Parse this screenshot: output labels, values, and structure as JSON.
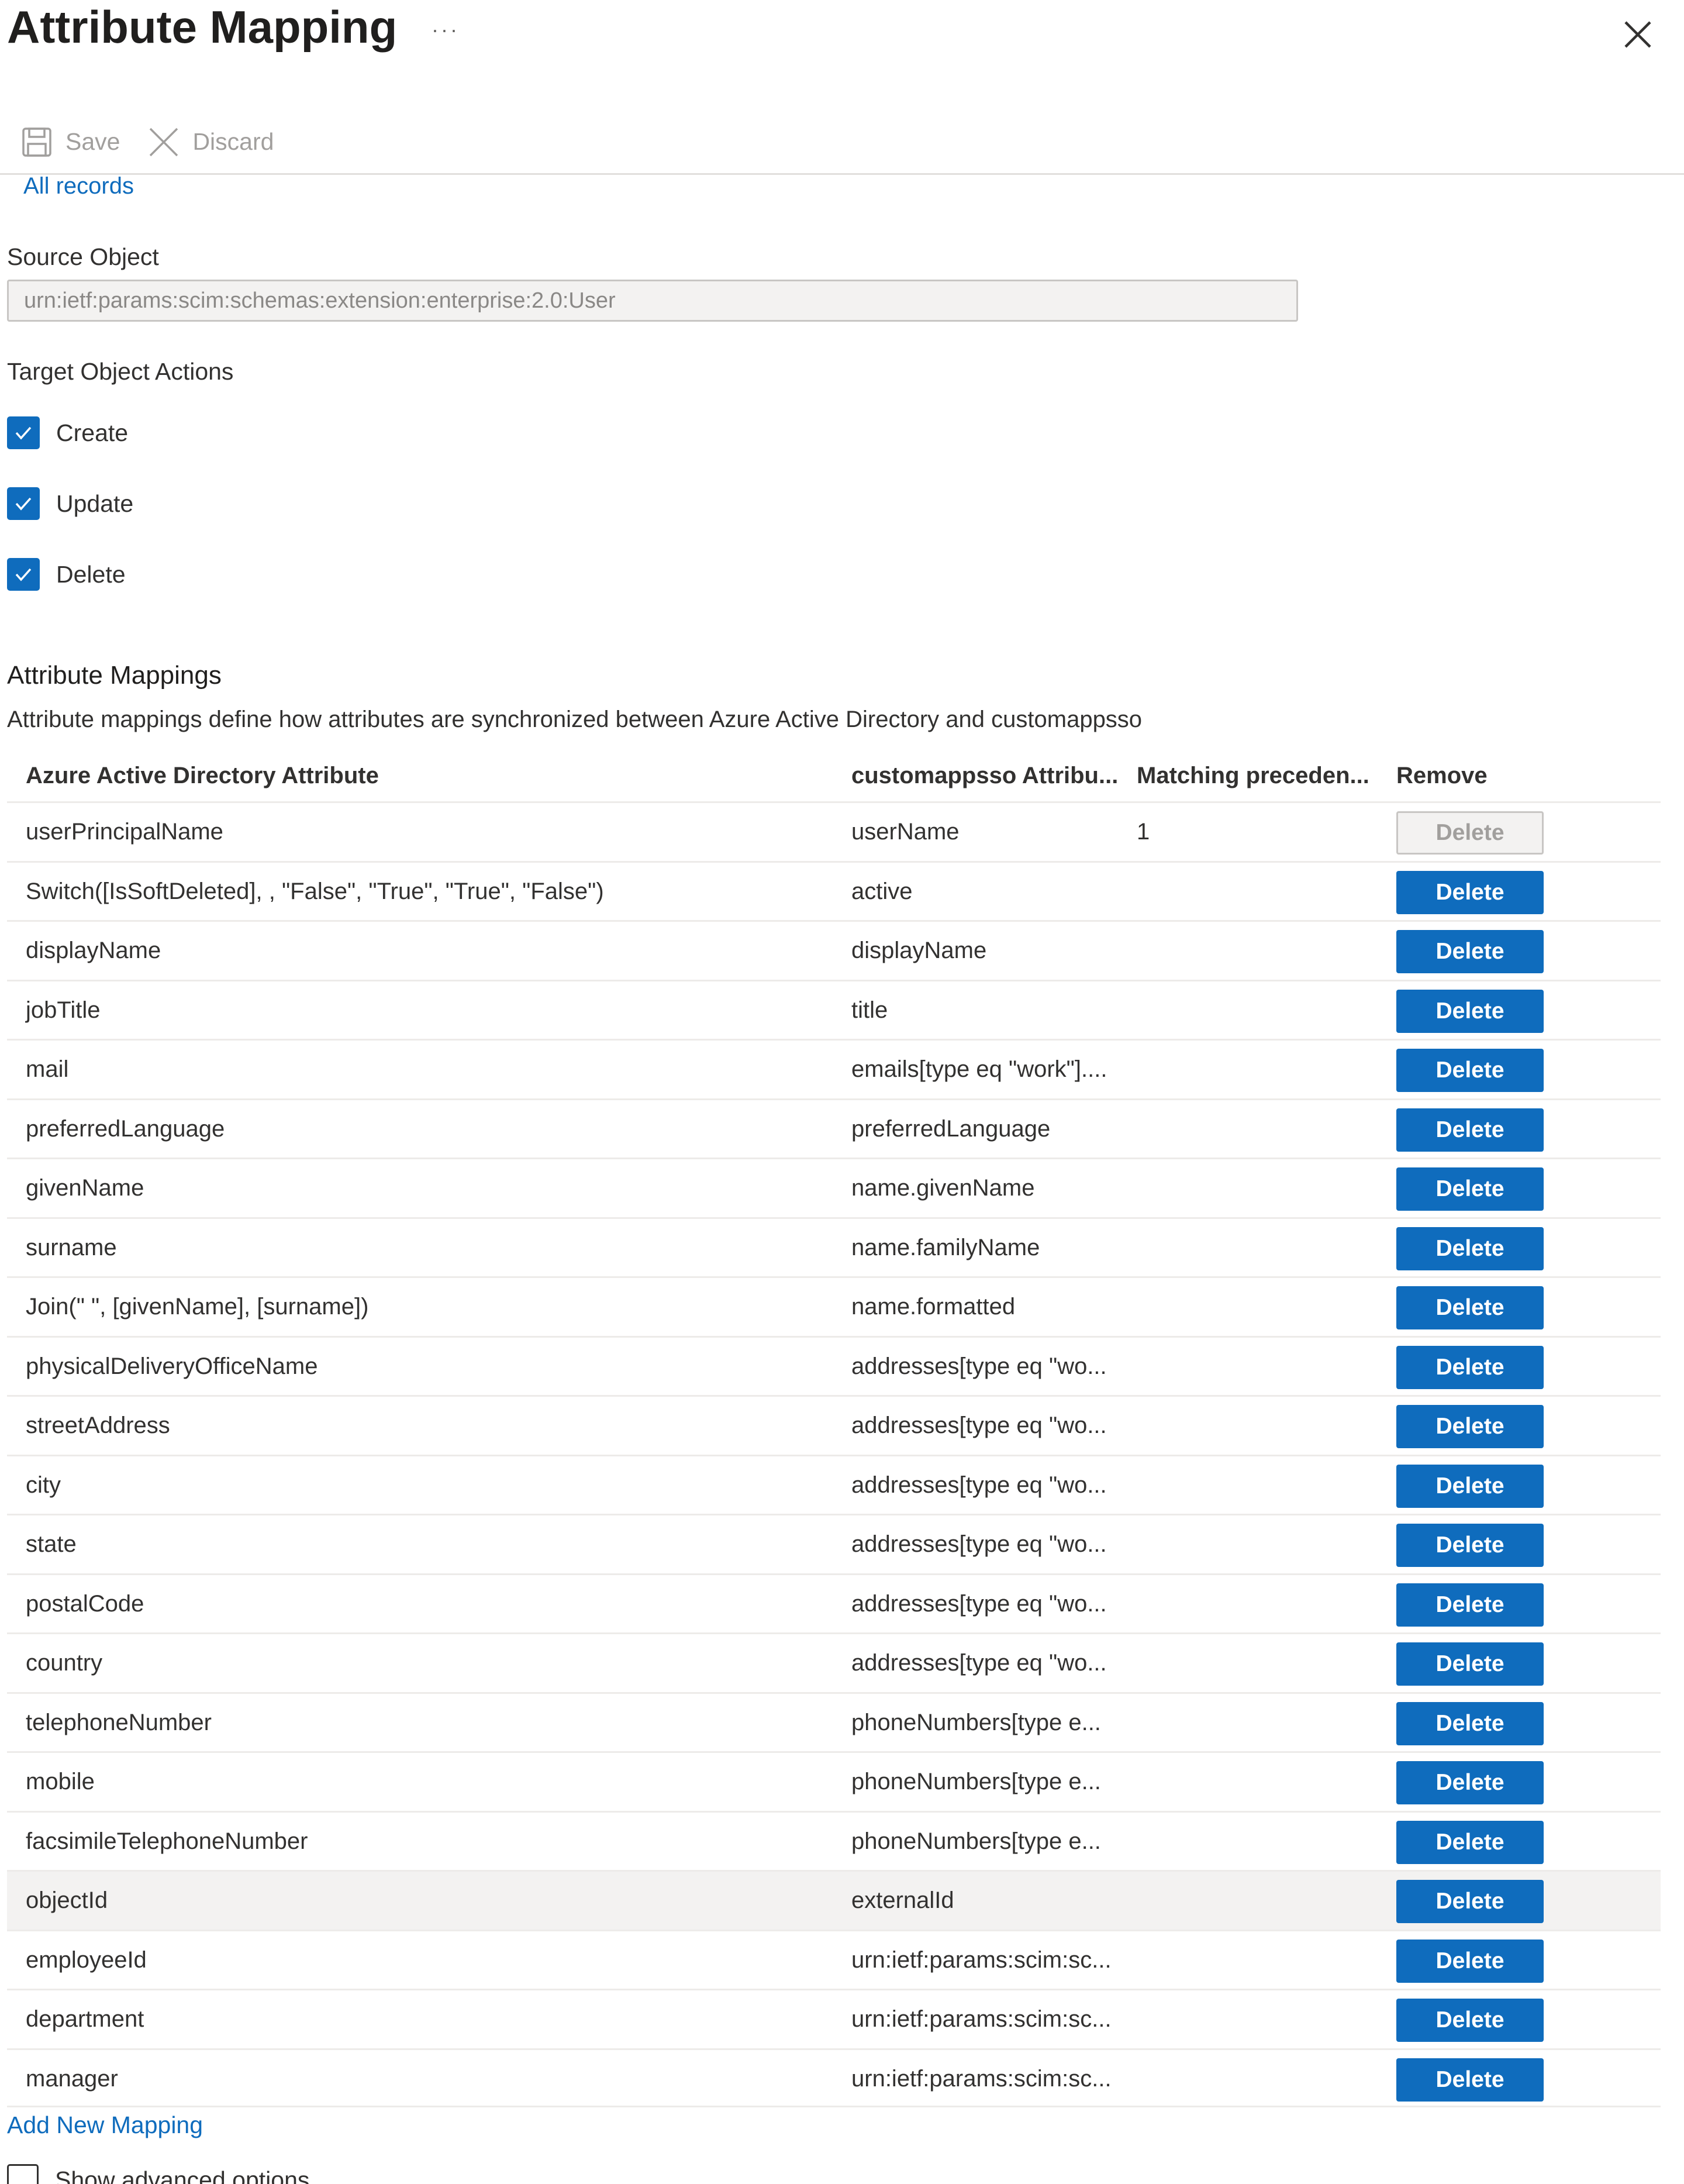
{
  "header": {
    "title": "Attribute Mapping",
    "more_label": "···",
    "close_icon": "close-icon"
  },
  "toolbar": {
    "save_label": "Save",
    "save_icon": "save-icon",
    "discard_label": "Discard",
    "discard_icon": "discard-icon"
  },
  "all_records_label": "All records",
  "source_object": {
    "label": "Source Object",
    "value": "urn:ietf:params:scim:schemas:extension:enterprise:2.0:User"
  },
  "target_actions": {
    "label": "Target Object Actions",
    "items": [
      {
        "label": "Create",
        "checked": true
      },
      {
        "label": "Update",
        "checked": true
      },
      {
        "label": "Delete",
        "checked": true
      }
    ]
  },
  "mappings": {
    "title": "Attribute Mappings",
    "description": "Attribute mappings define how attributes are synchronized between Azure Active Directory and customappsso",
    "columns": {
      "source": "Azure Active Directory Attribute",
      "target": "customappsso Attribu...",
      "precedence": "Matching preceden...",
      "remove": "Remove"
    },
    "delete_label": "Delete",
    "rows": [
      {
        "source": "userPrincipalName",
        "target": "userName",
        "precedence": "1"
      },
      {
        "source": "Switch([IsSoftDeleted], , \"False\", \"True\", \"True\", \"False\")",
        "target": "active",
        "precedence": ""
      },
      {
        "source": "displayName",
        "target": "displayName",
        "precedence": ""
      },
      {
        "source": "jobTitle",
        "target": "title",
        "precedence": ""
      },
      {
        "source": "mail",
        "target": "emails[type eq \"work\"]....",
        "precedence": ""
      },
      {
        "source": "preferredLanguage",
        "target": "preferredLanguage",
        "precedence": ""
      },
      {
        "source": "givenName",
        "target": "name.givenName",
        "precedence": ""
      },
      {
        "source": "surname",
        "target": "name.familyName",
        "precedence": ""
      },
      {
        "source": "Join(\" \", [givenName], [surname])",
        "target": "name.formatted",
        "precedence": ""
      },
      {
        "source": "physicalDeliveryOfficeName",
        "target": "addresses[type eq \"wo...",
        "precedence": ""
      },
      {
        "source": "streetAddress",
        "target": "addresses[type eq \"wo...",
        "precedence": ""
      },
      {
        "source": "city",
        "target": "addresses[type eq \"wo...",
        "precedence": ""
      },
      {
        "source": "state",
        "target": "addresses[type eq \"wo...",
        "precedence": ""
      },
      {
        "source": "postalCode",
        "target": "addresses[type eq \"wo...",
        "precedence": ""
      },
      {
        "source": "country",
        "target": "addresses[type eq \"wo...",
        "precedence": ""
      },
      {
        "source": "telephoneNumber",
        "target": "phoneNumbers[type e...",
        "precedence": ""
      },
      {
        "source": "mobile",
        "target": "phoneNumbers[type e...",
        "precedence": ""
      },
      {
        "source": "facsimileTelephoneNumber",
        "target": "phoneNumbers[type e...",
        "precedence": ""
      },
      {
        "source": "objectId",
        "target": "externalId",
        "precedence": ""
      },
      {
        "source": "employeeId",
        "target": "urn:ietf:params:scim:sc...",
        "precedence": ""
      },
      {
        "source": "department",
        "target": "urn:ietf:params:scim:sc...",
        "precedence": ""
      },
      {
        "source": "manager",
        "target": "urn:ietf:params:scim:sc...",
        "precedence": ""
      }
    ]
  },
  "add_new_mapping_label": "Add New Mapping",
  "advanced_options_label": "Show advanced options"
}
